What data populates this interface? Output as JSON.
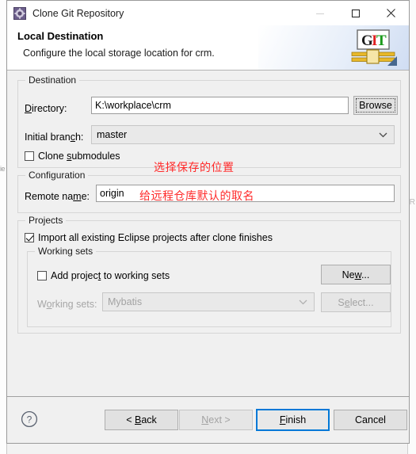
{
  "window": {
    "title": "Clone Git Repository",
    "icon": "git-repository-icon",
    "minimize_label": "Minimize",
    "maximize_label": "Maximize",
    "close_label": "Close"
  },
  "banner": {
    "title": "Local Destination",
    "subtitle": "Configure the local storage location for crm.",
    "logo_g": "G",
    "logo_i": "I",
    "logo_t": "T"
  },
  "destination": {
    "group_label": "Destination",
    "directory_label": "Directory:",
    "directory_value": "K:\\workplace\\crm",
    "browse_label": "Browse",
    "initial_branch_label": "Initial branch:",
    "initial_branch_value": "master",
    "clone_submodules_label": "Clone submodules",
    "annotation": "选择保存的位置"
  },
  "configuration": {
    "group_label": "Configuration",
    "remote_name_label": "Remote name:",
    "remote_name_value": "origin",
    "annotation": "给远程仓库默认的取名"
  },
  "projects": {
    "group_label": "Projects",
    "import_label": "Import all existing Eclipse projects after clone finishes",
    "working_sets": {
      "group_label": "Working sets",
      "add_project_label": "Add project to working sets",
      "new_label": "New...",
      "working_sets_label": "Working sets:",
      "working_sets_value": "Mybatis",
      "select_label": "Select..."
    }
  },
  "buttons": {
    "help": "?",
    "back": "< Back",
    "next": "Next >",
    "finish": "Finish",
    "cancel": "Cancel"
  },
  "background": {
    "left_fragment": "ie",
    "right_fragment": "R"
  },
  "colors": {
    "annotation_red": "#ff2a2a",
    "focus_blue": "#0078d7",
    "dialog_bg": "#f0f0f0",
    "banner_bg": "#ffffff",
    "logo_g": "#1b1b1b",
    "logo_i": "#e02020",
    "logo_t": "#1a9a1a",
    "logo_belt": "#e8b82a"
  }
}
